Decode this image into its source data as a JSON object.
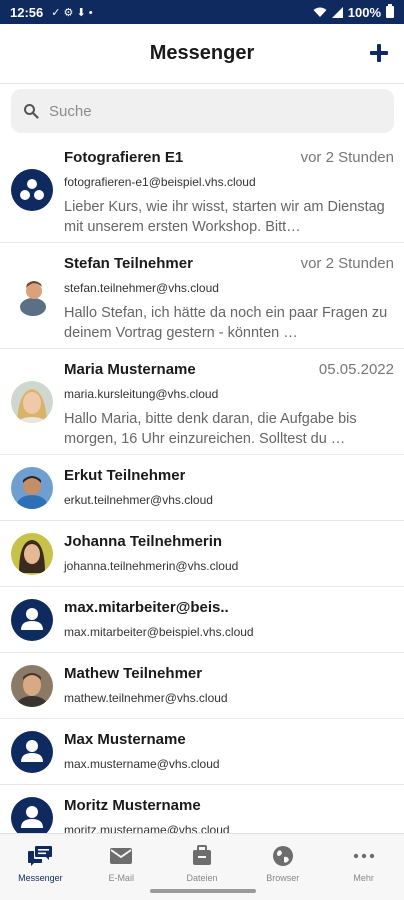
{
  "status_bar": {
    "time": "12:56",
    "left_icons": "✓ ⚙ ⬇ •",
    "battery": "100%"
  },
  "header": {
    "title": "Messenger"
  },
  "search": {
    "placeholder": "Suche"
  },
  "conversations": [
    {
      "name": "Fotografieren E1",
      "time": "vor 2 Stunden",
      "email": "fotografieren-e1@beispiel.vhs.cloud",
      "preview": "Lieber Kurs,  wie ihr wisst, starten wir am Dienstag mit unserem ersten Workshop. Bitt…",
      "avatar": "group-avatar-icon"
    },
    {
      "name": "Stefan Teilnehmer",
      "time": "vor 2 Stunden",
      "email": "stefan.teilnehmer@vhs.cloud",
      "preview": "Hallo Stefan,  ich hätte da noch ein paar Fragen zu deinem Vortrag gestern - könnten …",
      "avatar": "photo"
    },
    {
      "name": "Maria Mustername",
      "time": "05.05.2022",
      "email": "maria.kursleitung@vhs.cloud",
      "preview": "Hallo Maria, bitte denk daran, die Aufgabe bis morgen, 16 Uhr einzureichen. Solltest du …",
      "avatar": "photo"
    },
    {
      "name": "Erkut Teilnehmer",
      "time": "",
      "email": "erkut.teilnehmer@vhs.cloud",
      "preview": "",
      "avatar": "photo"
    },
    {
      "name": "Johanna Teilnehmerin",
      "time": "",
      "email": "johanna.teilnehmerin@vhs.cloud",
      "preview": "",
      "avatar": "photo"
    },
    {
      "name": "max.mitarbeiter@beis..",
      "time": "",
      "email": "max.mitarbeiter@beispiel.vhs.cloud",
      "preview": "",
      "avatar": "user-avatar-icon"
    },
    {
      "name": "Mathew Teilnehmer",
      "time": "",
      "email": "mathew.teilnehmer@vhs.cloud",
      "preview": "",
      "avatar": "photo"
    },
    {
      "name": "Max Mustername",
      "time": "",
      "email": "max.mustername@vhs.cloud",
      "preview": "",
      "avatar": "user-avatar-icon"
    },
    {
      "name": "Moritz Mustername",
      "time": "",
      "email": "moritz.mustername@vhs.cloud",
      "preview": "",
      "avatar": "user-avatar-icon"
    }
  ],
  "bottom_nav": [
    {
      "label": "Messenger",
      "icon": "chat-icon",
      "active": true
    },
    {
      "label": "E-Mail",
      "icon": "mail-icon",
      "active": false
    },
    {
      "label": "Dateien",
      "icon": "folder-icon",
      "active": false
    },
    {
      "label": "Browser",
      "icon": "globe-icon",
      "active": false
    },
    {
      "label": "Mehr",
      "icon": "more-icon",
      "active": false
    }
  ],
  "colors": {
    "primary": "#0f2a5e",
    "muted_text": "#777777",
    "search_bg": "#f0f0f0"
  }
}
